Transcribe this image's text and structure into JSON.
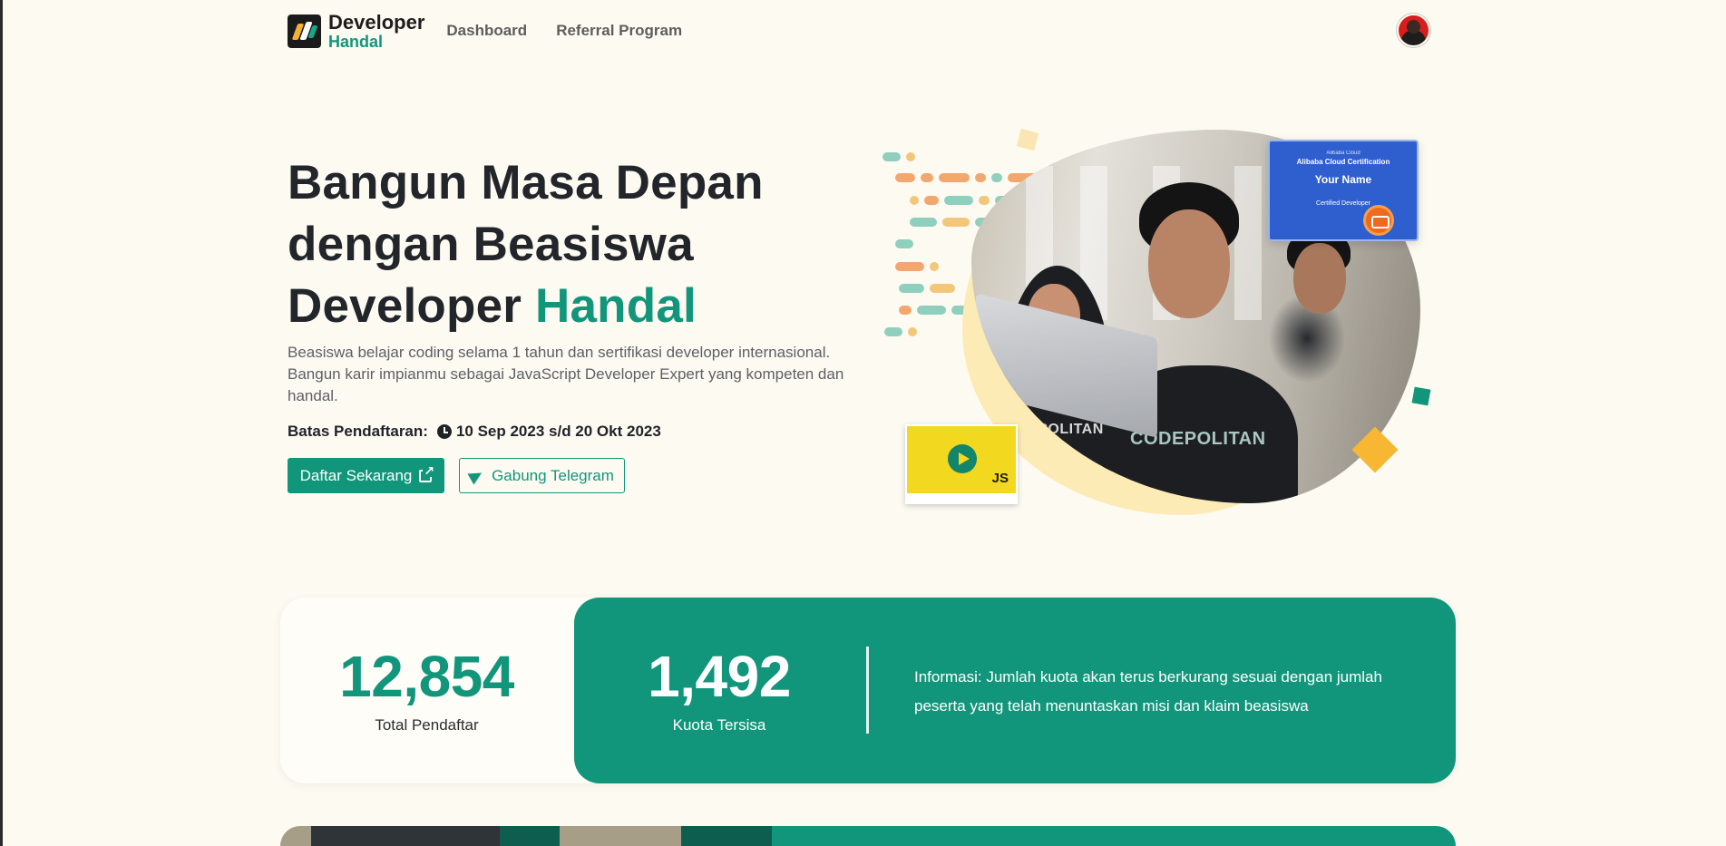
{
  "brand": {
    "name_top": "Developer",
    "name_bottom": "Handal"
  },
  "nav": {
    "dashboard": "Dashboard",
    "referral": "Referral Program"
  },
  "hero": {
    "title_line1": "Bangun Masa Depan",
    "title_line2": "dengan Beasiswa",
    "title_line3_plain": "Developer ",
    "title_line3_accent": "Handal",
    "description": "Beasiswa belajar coding selama 1 tahun dan sertifikasi developer internasional. Bangun karir impianmu sebagai JavaScript Developer Expert yang kompeten dan handal.",
    "deadline_label": "Batas Pendaftaran:",
    "deadline_dates": "10 Sep 2023 s/d 20 Okt 2023",
    "btn_register": "Daftar Sekarang",
    "btn_telegram": "Gabung Telegram"
  },
  "hero_image": {
    "shirt_text_1": "CODEPOLITAN",
    "shirt_text_2": "CODEPOLITAN",
    "cert_org": "Alibaba Cloud",
    "cert_title": "Alibaba Cloud Certification",
    "cert_name": "Your Name",
    "cert_role": "Certified Developer",
    "video_badge": "JS"
  },
  "stats": {
    "total_value": "12,854",
    "total_label": "Total Pendaftar",
    "quota_value": "1,492",
    "quota_label": "Kuota Tersisa",
    "info": "Informasi: Jumlah kuota akan terus berkurang sesuai dengan jumlah peserta yang telah menuntaskan misi dan klaim beasiswa"
  },
  "colors": {
    "accent": "#12967b",
    "background": "#fdfaf2",
    "text": "#22262b"
  }
}
